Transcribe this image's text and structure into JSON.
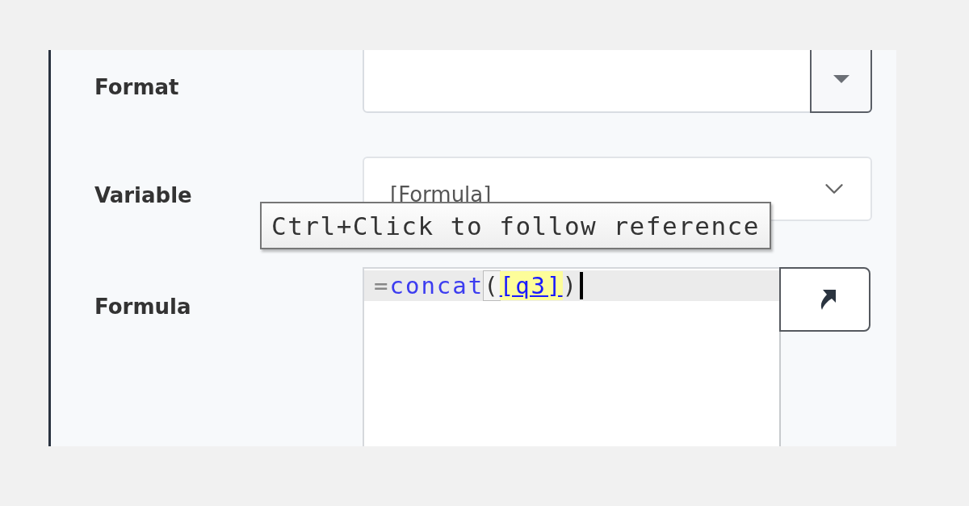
{
  "fields": [
    {
      "label": "Format",
      "kind": "combo"
    },
    {
      "label": "Variable",
      "kind": "select",
      "value": "[Formula]"
    },
    {
      "label": "Formula",
      "kind": "editor",
      "focused": true,
      "tokens": [
        {
          "text": "=",
          "kind": "operator"
        },
        {
          "text": "concat",
          "kind": "function"
        },
        {
          "text": "(",
          "kind": "paren",
          "matched": true
        },
        {
          "text": "[q3]",
          "kind": "reference",
          "highlighted": true
        },
        {
          "text": ")",
          "kind": "paren",
          "matched": false
        }
      ]
    }
  ],
  "tooltip": {
    "text": "Ctrl+Click to follow reference"
  }
}
